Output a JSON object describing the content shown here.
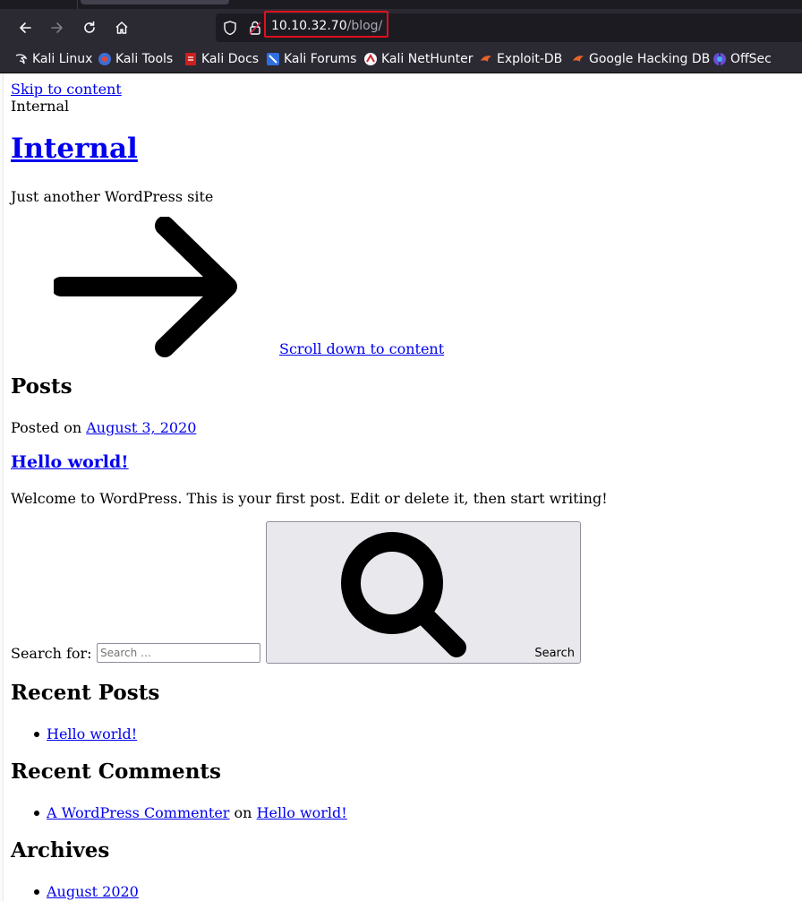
{
  "browser": {
    "url_host": "10.10.32.70",
    "url_path": "/blog/",
    "highlight_color": "#e0101a",
    "bookmarks": [
      {
        "label": "Kali Linux",
        "icon": "kali-dragon-icon"
      },
      {
        "label": "Kali Tools",
        "icon": "kali-tools-icon"
      },
      {
        "label": "Kali Docs",
        "icon": "kali-docs-icon"
      },
      {
        "label": "Kali Forums",
        "icon": "kali-forums-icon"
      },
      {
        "label": "Kali NetHunter",
        "icon": "nethunter-icon"
      },
      {
        "label": "Exploit-DB",
        "icon": "exploit-db-icon"
      },
      {
        "label": "Google Hacking DB",
        "icon": "ghdb-icon"
      },
      {
        "label": "OffSec",
        "icon": "offsec-icon"
      }
    ]
  },
  "page": {
    "skip_link": "Skip to content",
    "site_name_small": "Internal",
    "site_title": "Internal",
    "tagline": "Just another WordPress site",
    "scroll_link": "Scroll down to content",
    "posts_heading": "Posts",
    "posted_on_label": "Posted on",
    "post_date": "August 3, 2020",
    "post_title": "Hello world!",
    "post_excerpt": "Welcome to WordPress. This is your first post. Edit or delete it, then start writing!",
    "search_label": "Search for:",
    "search_placeholder": "Search …",
    "search_button": "Search",
    "recent_posts_heading": "Recent Posts",
    "recent_posts": [
      "Hello world!"
    ],
    "recent_comments_heading": "Recent Comments",
    "comment_author": "A WordPress Commenter",
    "comment_on": "on",
    "comment_post": "Hello world!",
    "archives_heading": "Archives",
    "archives": [
      "August 2020"
    ]
  }
}
